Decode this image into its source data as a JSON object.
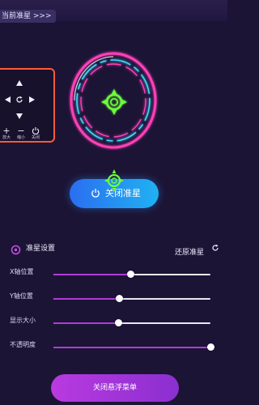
{
  "top_bar": {
    "current_label": "当前准星 >>>"
  },
  "controls": {
    "add_label": "放大",
    "shrink_label": "缩小",
    "close_label": "关闭",
    "add_glyph": "+",
    "shrink_glyph": "−"
  },
  "main_button": {
    "label": "关闭准星"
  },
  "settings": {
    "title": "准星设置",
    "reset_label": "还原准星",
    "sliders": [
      {
        "label": "X轴位置",
        "value": 0.49
      },
      {
        "label": "Y轴位置",
        "value": 0.42
      },
      {
        "label": "显示大小",
        "value": 0.41
      },
      {
        "label": "不透明度",
        "value": 0.999
      }
    ]
  },
  "close_menu_button": {
    "label": "关闭悬浮菜单"
  },
  "colors": {
    "background": "#1c1435",
    "ring_pink": "#ff3fb8",
    "ring_blue": "#3fd8ff",
    "crosshair_green": "#6dff3a",
    "slider_fill": "#b23bd6",
    "panel_border": "#ff5a36"
  }
}
